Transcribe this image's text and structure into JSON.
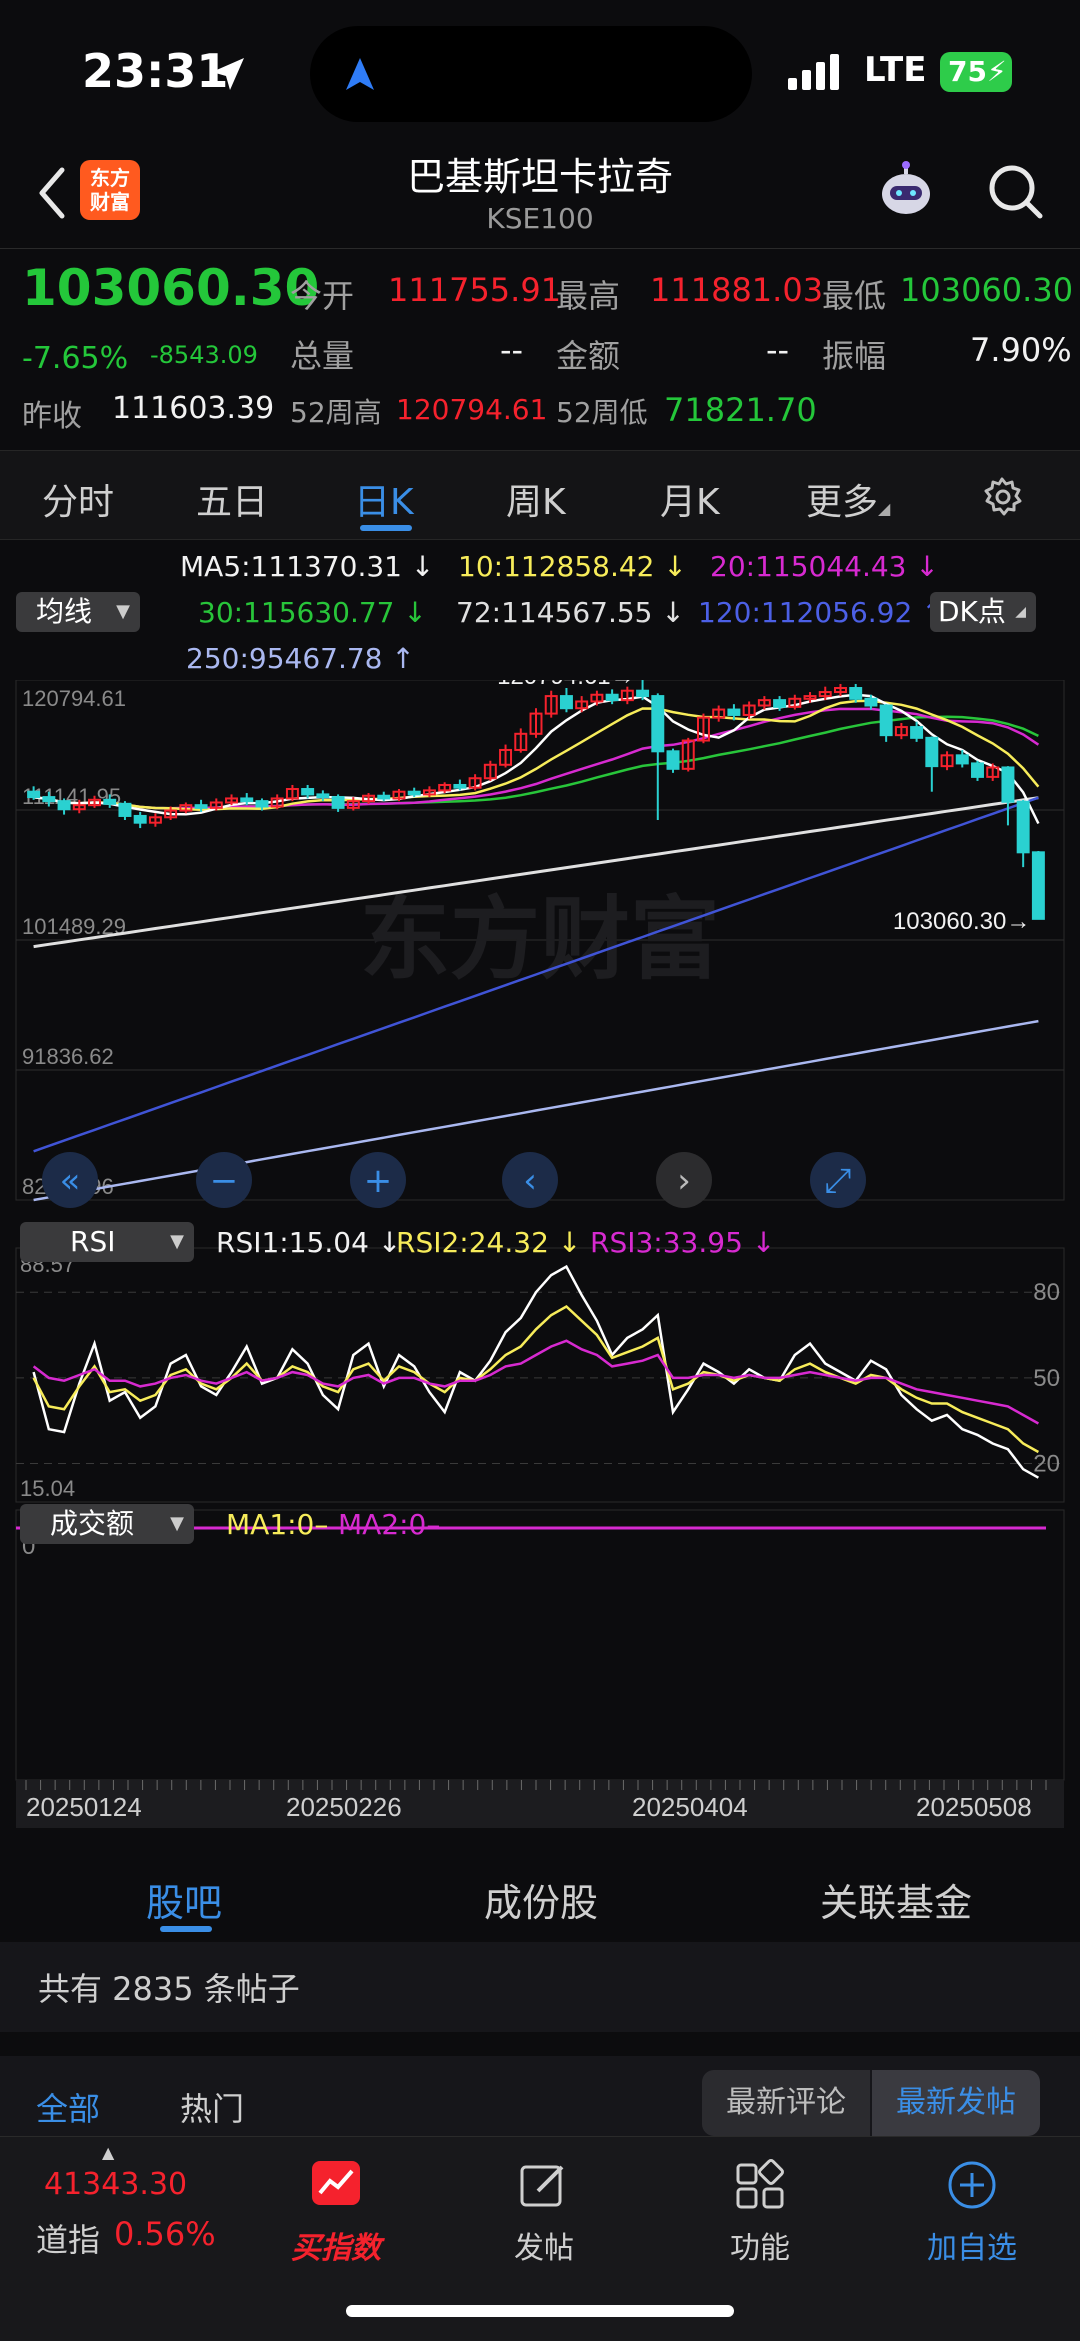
{
  "status_bar": {
    "time": "23:31",
    "network": "LTE",
    "battery": "75"
  },
  "nav": {
    "logo_text_1": "东方",
    "logo_text_2": "财富",
    "title": "巴基斯坦卡拉奇",
    "subtitle": "KSE100"
  },
  "quote": {
    "price": "103060.30",
    "change_pct": "-7.65%",
    "change_abs": "-8543.09",
    "open_label": "今开",
    "open": "111755.91",
    "high_label": "最高",
    "high": "111881.03",
    "low_label": "最低",
    "low": "103060.30",
    "volume_label": "总量",
    "volume": "--",
    "amount_label": "金额",
    "amount": "--",
    "amplitude_label": "振幅",
    "amplitude": "7.90%",
    "prev_close_label": "昨收",
    "prev_close": "111603.39",
    "wk52_high_label": "52周高",
    "wk52_high": "120794.61",
    "wk52_low_label": "52周低",
    "wk52_low": "71821.70"
  },
  "period_tabs": [
    "分时",
    "五日",
    "日K",
    "周K",
    "月K",
    "更多"
  ],
  "ma_legend": {
    "selector": "均线",
    "ma5": "MA5:111370.31",
    "ma10": "10:112858.42",
    "ma20": "20:115044.43",
    "ma30": "30:115630.77",
    "ma72": "72:114567.55",
    "ma120": "120:112056.92",
    "ma250": "250:95467.78",
    "dk_button": "DK点"
  },
  "colors": {
    "up": "#f5222d",
    "down": "#2ad1d1",
    "accent": "#3a8ee6",
    "ma5": "#ffffff",
    "ma10": "#f7ec5a",
    "ma20": "#d72ad0",
    "ma30": "#28c53a",
    "ma72": "#e0e0e0",
    "ma120": "#4054d6",
    "ma250": "#aab8f0"
  },
  "chart_data": [
    {
      "type": "candlestick",
      "y_axis_labels": [
        "120794.61",
        "111141.95",
        "101489.29",
        "91836.62",
        "82183.96"
      ],
      "ylim": [
        82183.96,
        120794.61
      ],
      "high_marker": "120794.61",
      "last_marker": "103060.30",
      "x_tick_labels": [
        "20250124",
        "20250226",
        "20250404",
        "20250508"
      ],
      "candles": [
        [
          112500,
          112100,
          112900,
          111900
        ],
        [
          112100,
          111800,
          112500,
          111400
        ],
        [
          111800,
          111200,
          112000,
          110800
        ],
        [
          111200,
          111500,
          111900,
          110900
        ],
        [
          111500,
          111900,
          112200,
          111300
        ],
        [
          111900,
          111600,
          112300,
          111300
        ],
        [
          111600,
          110700,
          111800,
          110400
        ],
        [
          110700,
          110200,
          111000,
          109800
        ],
        [
          110200,
          110600,
          110900,
          109900
        ],
        [
          110600,
          111100,
          111400,
          110400
        ],
        [
          111100,
          111500,
          111700,
          110900
        ],
        [
          111500,
          111300,
          111900,
          111000
        ],
        [
          111300,
          111700,
          112000,
          111100
        ],
        [
          111700,
          112000,
          112300,
          111500
        ],
        [
          112000,
          111800,
          112400,
          111500
        ],
        [
          111800,
          111400,
          112000,
          111100
        ],
        [
          111400,
          112000,
          112300,
          111200
        ],
        [
          112000,
          112700,
          113000,
          111800
        ],
        [
          112700,
          112300,
          113000,
          112000
        ],
        [
          112300,
          112100,
          112600,
          111800
        ],
        [
          112100,
          111300,
          112300,
          111000
        ],
        [
          111300,
          111800,
          112100,
          111100
        ],
        [
          111800,
          112200,
          112400,
          111600
        ],
        [
          112200,
          112000,
          112500,
          111800
        ],
        [
          112000,
          112500,
          112700,
          111800
        ],
        [
          112500,
          112300,
          112800,
          112100
        ],
        [
          112300,
          112600,
          112900,
          112100
        ],
        [
          112600,
          113000,
          113200,
          112400
        ],
        [
          113000,
          112800,
          113400,
          112600
        ],
        [
          112800,
          113500,
          113800,
          112600
        ],
        [
          113500,
          114500,
          114800,
          113300
        ],
        [
          114500,
          115600,
          116000,
          114300
        ],
        [
          115600,
          116800,
          117200,
          115400
        ],
        [
          116800,
          118300,
          118700,
          116500
        ],
        [
          118300,
          119600,
          120000,
          118000
        ],
        [
          119600,
          118700,
          120200,
          118400
        ],
        [
          118700,
          119200,
          119600,
          118400
        ],
        [
          119200,
          119700,
          120000,
          118900
        ],
        [
          119700,
          119300,
          120100,
          119000
        ],
        [
          119300,
          120000,
          120300,
          119000
        ],
        [
          120000,
          119600,
          120794,
          119300
        ],
        [
          119600,
          115500,
          119800,
          110400
        ],
        [
          115500,
          114200,
          115700,
          113900
        ],
        [
          114200,
          116300,
          116500,
          114000
        ],
        [
          116300,
          118000,
          118300,
          116100
        ],
        [
          118000,
          118600,
          118900,
          117700
        ],
        [
          118600,
          118200,
          119000,
          117800
        ],
        [
          118200,
          118900,
          119200,
          117900
        ],
        [
          118900,
          119300,
          119600,
          118600
        ],
        [
          119300,
          118800,
          119600,
          118500
        ],
        [
          118800,
          119400,
          119700,
          118600
        ],
        [
          119400,
          119600,
          119900,
          119100
        ],
        [
          119600,
          119900,
          120300,
          119300
        ],
        [
          119900,
          120200,
          120500,
          119600
        ],
        [
          120200,
          119400,
          120500,
          119100
        ],
        [
          119400,
          118900,
          119700,
          118600
        ],
        [
          118900,
          116700,
          119000,
          116200
        ],
        [
          116700,
          117300,
          117600,
          116400
        ],
        [
          117300,
          116500,
          117700,
          116200
        ],
        [
          116500,
          114400,
          116600,
          112500
        ],
        [
          114400,
          115200,
          115500,
          114100
        ],
        [
          115200,
          114600,
          115600,
          114300
        ],
        [
          114600,
          113600,
          114800,
          113300
        ],
        [
          113600,
          114300,
          114600,
          113300
        ],
        [
          114300,
          111755,
          114400,
          110000
        ],
        [
          111755,
          108000,
          111881,
          106900
        ],
        [
          108000,
          103060,
          108100,
          103060
        ]
      ]
    },
    {
      "type": "line",
      "indicator": "RSI",
      "selector": "RSI",
      "rsi1_label": "RSI1:15.04",
      "rsi2_label": "RSI2:24.32",
      "rsi3_label": "RSI3:33.95",
      "y_axis_left": [
        "88.57",
        "15.04"
      ],
      "y_axis_right": [
        "80",
        "50",
        "20"
      ],
      "ylim": [
        10,
        92
      ],
      "series": [
        {
          "name": "RSI1",
          "values": [
            52,
            32,
            31,
            48,
            62,
            42,
            45,
            36,
            40,
            55,
            58,
            47,
            44,
            52,
            61,
            48,
            50,
            60,
            55,
            44,
            39,
            58,
            62,
            47,
            58,
            54,
            45,
            38,
            52,
            49,
            56,
            66,
            71,
            80,
            86,
            89,
            79,
            70,
            58,
            64,
            67,
            72,
            38,
            46,
            55,
            52,
            48,
            53,
            50,
            49,
            58,
            62,
            55,
            52,
            49,
            56,
            53,
            44,
            39,
            35,
            37,
            32,
            30,
            27,
            25,
            18,
            15
          ]
        },
        {
          "name": "RSI2",
          "values": [
            50,
            40,
            39,
            47,
            54,
            45,
            46,
            42,
            44,
            51,
            53,
            48,
            46,
            50,
            55,
            49,
            50,
            54,
            52,
            47,
            45,
            53,
            55,
            49,
            54,
            52,
            48,
            45,
            50,
            49,
            53,
            58,
            61,
            67,
            72,
            75,
            70,
            65,
            57,
            59,
            61,
            64,
            46,
            48,
            52,
            51,
            49,
            51,
            50,
            49,
            53,
            55,
            52,
            50,
            48,
            51,
            50,
            46,
            43,
            41,
            41,
            38,
            36,
            34,
            32,
            27,
            24
          ]
        },
        {
          "name": "RSI3",
          "values": [
            54,
            50,
            49,
            51,
            53,
            49,
            49,
            47,
            48,
            50,
            51,
            49,
            48,
            50,
            52,
            49,
            50,
            52,
            51,
            48,
            47,
            50,
            51,
            48,
            50,
            50,
            48,
            47,
            49,
            49,
            51,
            54,
            55,
            58,
            61,
            63,
            60,
            58,
            54,
            55,
            56,
            58,
            50,
            50,
            51,
            51,
            50,
            51,
            50,
            50,
            51,
            52,
            51,
            50,
            49,
            50,
            50,
            48,
            46,
            45,
            44,
            43,
            42,
            41,
            40,
            37,
            34
          ]
        }
      ]
    },
    {
      "type": "bar",
      "indicator": "成交额",
      "selector": "成交额",
      "ma1_label": "MA1:0–",
      "ma2_label": "MA2:0–",
      "y_axis_labels": [
        "0"
      ],
      "values": []
    }
  ],
  "chart_controls": [
    "fast-back",
    "zoom-out",
    "zoom-in",
    "prev",
    "next",
    "fullscreen"
  ],
  "stock_tabs": [
    "股吧",
    "成份股",
    "关联基金"
  ],
  "posts": {
    "count_text": "共有 2835 条帖子"
  },
  "filter_tabs": [
    "全部",
    "热门"
  ],
  "sort_segments": [
    "最新评论",
    "最新发帖"
  ],
  "bottom_bar": {
    "ticker_value": "41343.30",
    "ticker_name": "道指",
    "ticker_change": "0.56%",
    "buy_index_label": "买指数",
    "post_label": "发帖",
    "function_label": "功能",
    "add_watch_label": "加自选"
  }
}
